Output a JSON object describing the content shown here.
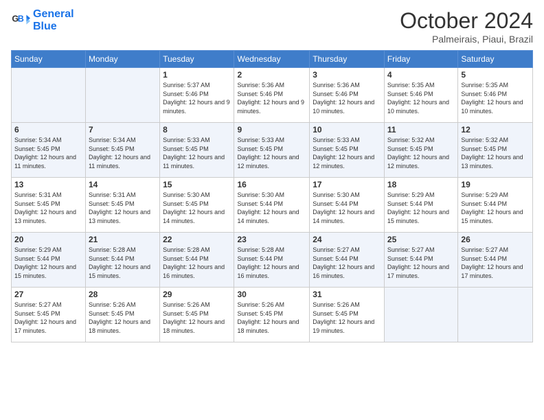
{
  "logo": {
    "text_general": "General",
    "text_blue": "Blue"
  },
  "header": {
    "month": "October 2024",
    "location": "Palmeirais, Piaui, Brazil"
  },
  "weekdays": [
    "Sunday",
    "Monday",
    "Tuesday",
    "Wednesday",
    "Thursday",
    "Friday",
    "Saturday"
  ],
  "weeks": [
    [
      {
        "day": "",
        "sunrise": "",
        "sunset": "",
        "daylight": ""
      },
      {
        "day": "",
        "sunrise": "",
        "sunset": "",
        "daylight": ""
      },
      {
        "day": "1",
        "sunrise": "Sunrise: 5:37 AM",
        "sunset": "Sunset: 5:46 PM",
        "daylight": "Daylight: 12 hours and 9 minutes."
      },
      {
        "day": "2",
        "sunrise": "Sunrise: 5:36 AM",
        "sunset": "Sunset: 5:46 PM",
        "daylight": "Daylight: 12 hours and 9 minutes."
      },
      {
        "day": "3",
        "sunrise": "Sunrise: 5:36 AM",
        "sunset": "Sunset: 5:46 PM",
        "daylight": "Daylight: 12 hours and 10 minutes."
      },
      {
        "day": "4",
        "sunrise": "Sunrise: 5:35 AM",
        "sunset": "Sunset: 5:46 PM",
        "daylight": "Daylight: 12 hours and 10 minutes."
      },
      {
        "day": "5",
        "sunrise": "Sunrise: 5:35 AM",
        "sunset": "Sunset: 5:46 PM",
        "daylight": "Daylight: 12 hours and 10 minutes."
      }
    ],
    [
      {
        "day": "6",
        "sunrise": "Sunrise: 5:34 AM",
        "sunset": "Sunset: 5:45 PM",
        "daylight": "Daylight: 12 hours and 11 minutes."
      },
      {
        "day": "7",
        "sunrise": "Sunrise: 5:34 AM",
        "sunset": "Sunset: 5:45 PM",
        "daylight": "Daylight: 12 hours and 11 minutes."
      },
      {
        "day": "8",
        "sunrise": "Sunrise: 5:33 AM",
        "sunset": "Sunset: 5:45 PM",
        "daylight": "Daylight: 12 hours and 11 minutes."
      },
      {
        "day": "9",
        "sunrise": "Sunrise: 5:33 AM",
        "sunset": "Sunset: 5:45 PM",
        "daylight": "Daylight: 12 hours and 12 minutes."
      },
      {
        "day": "10",
        "sunrise": "Sunrise: 5:33 AM",
        "sunset": "Sunset: 5:45 PM",
        "daylight": "Daylight: 12 hours and 12 minutes."
      },
      {
        "day": "11",
        "sunrise": "Sunrise: 5:32 AM",
        "sunset": "Sunset: 5:45 PM",
        "daylight": "Daylight: 12 hours and 12 minutes."
      },
      {
        "day": "12",
        "sunrise": "Sunrise: 5:32 AM",
        "sunset": "Sunset: 5:45 PM",
        "daylight": "Daylight: 12 hours and 13 minutes."
      }
    ],
    [
      {
        "day": "13",
        "sunrise": "Sunrise: 5:31 AM",
        "sunset": "Sunset: 5:45 PM",
        "daylight": "Daylight: 12 hours and 13 minutes."
      },
      {
        "day": "14",
        "sunrise": "Sunrise: 5:31 AM",
        "sunset": "Sunset: 5:45 PM",
        "daylight": "Daylight: 12 hours and 13 minutes."
      },
      {
        "day": "15",
        "sunrise": "Sunrise: 5:30 AM",
        "sunset": "Sunset: 5:45 PM",
        "daylight": "Daylight: 12 hours and 14 minutes."
      },
      {
        "day": "16",
        "sunrise": "Sunrise: 5:30 AM",
        "sunset": "Sunset: 5:44 PM",
        "daylight": "Daylight: 12 hours and 14 minutes."
      },
      {
        "day": "17",
        "sunrise": "Sunrise: 5:30 AM",
        "sunset": "Sunset: 5:44 PM",
        "daylight": "Daylight: 12 hours and 14 minutes."
      },
      {
        "day": "18",
        "sunrise": "Sunrise: 5:29 AM",
        "sunset": "Sunset: 5:44 PM",
        "daylight": "Daylight: 12 hours and 15 minutes."
      },
      {
        "day": "19",
        "sunrise": "Sunrise: 5:29 AM",
        "sunset": "Sunset: 5:44 PM",
        "daylight": "Daylight: 12 hours and 15 minutes."
      }
    ],
    [
      {
        "day": "20",
        "sunrise": "Sunrise: 5:29 AM",
        "sunset": "Sunset: 5:44 PM",
        "daylight": "Daylight: 12 hours and 15 minutes."
      },
      {
        "day": "21",
        "sunrise": "Sunrise: 5:28 AM",
        "sunset": "Sunset: 5:44 PM",
        "daylight": "Daylight: 12 hours and 15 minutes."
      },
      {
        "day": "22",
        "sunrise": "Sunrise: 5:28 AM",
        "sunset": "Sunset: 5:44 PM",
        "daylight": "Daylight: 12 hours and 16 minutes."
      },
      {
        "day": "23",
        "sunrise": "Sunrise: 5:28 AM",
        "sunset": "Sunset: 5:44 PM",
        "daylight": "Daylight: 12 hours and 16 minutes."
      },
      {
        "day": "24",
        "sunrise": "Sunrise: 5:27 AM",
        "sunset": "Sunset: 5:44 PM",
        "daylight": "Daylight: 12 hours and 16 minutes."
      },
      {
        "day": "25",
        "sunrise": "Sunrise: 5:27 AM",
        "sunset": "Sunset: 5:44 PM",
        "daylight": "Daylight: 12 hours and 17 minutes."
      },
      {
        "day": "26",
        "sunrise": "Sunrise: 5:27 AM",
        "sunset": "Sunset: 5:44 PM",
        "daylight": "Daylight: 12 hours and 17 minutes."
      }
    ],
    [
      {
        "day": "27",
        "sunrise": "Sunrise: 5:27 AM",
        "sunset": "Sunset: 5:45 PM",
        "daylight": "Daylight: 12 hours and 17 minutes."
      },
      {
        "day": "28",
        "sunrise": "Sunrise: 5:26 AM",
        "sunset": "Sunset: 5:45 PM",
        "daylight": "Daylight: 12 hours and 18 minutes."
      },
      {
        "day": "29",
        "sunrise": "Sunrise: 5:26 AM",
        "sunset": "Sunset: 5:45 PM",
        "daylight": "Daylight: 12 hours and 18 minutes."
      },
      {
        "day": "30",
        "sunrise": "Sunrise: 5:26 AM",
        "sunset": "Sunset: 5:45 PM",
        "daylight": "Daylight: 12 hours and 18 minutes."
      },
      {
        "day": "31",
        "sunrise": "Sunrise: 5:26 AM",
        "sunset": "Sunset: 5:45 PM",
        "daylight": "Daylight: 12 hours and 19 minutes."
      },
      {
        "day": "",
        "sunrise": "",
        "sunset": "",
        "daylight": ""
      },
      {
        "day": "",
        "sunrise": "",
        "sunset": "",
        "daylight": ""
      }
    ]
  ]
}
